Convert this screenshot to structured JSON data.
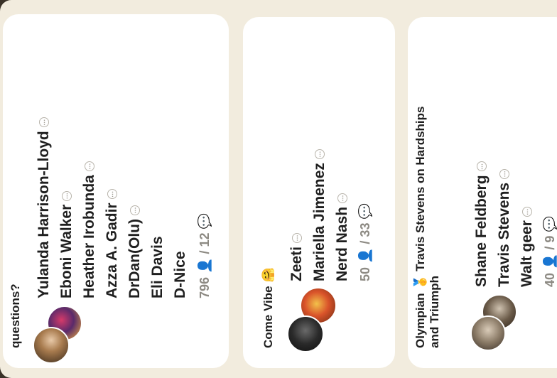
{
  "rooms": [
    {
      "title": "questions?",
      "speakers": [
        "Yulanda Harrison-Lloyd",
        "Eboni Walker",
        "Heather Irobunda",
        "Azza A. Gadir",
        "DrDan(Olu)",
        "Eli Davis",
        "D-Nice"
      ],
      "stats": "796 👤 / 12 💬"
    },
    {
      "title": "Come Vibe 🤗",
      "speakers": [
        "Zeeti",
        "Mariella Jimenez",
        "Nerd Nash"
      ],
      "stats": "50 👤 / 33 💬"
    },
    {
      "title_line1": "Olympian 🥇 Travis Stevens on Hardships",
      "title_line2": "and Triumph",
      "speakers": [
        "Shane Feldberg",
        "Travis Stevens",
        "Walt geer"
      ],
      "stats": "40 👤 / 9 💬"
    }
  ],
  "colors": {
    "background": "#f2ecde",
    "card": "#ffffff",
    "text": "#1f1f1f",
    "muted": "#8d8a83"
  }
}
